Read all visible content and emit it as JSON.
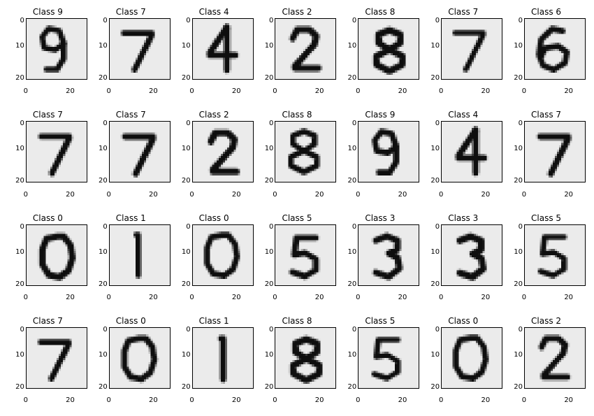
{
  "grid": {
    "rows": 4,
    "cols": 7
  },
  "axes": {
    "y_ticks": [
      0,
      10,
      20
    ],
    "x_ticks": [
      0,
      20
    ],
    "xlim": [
      0,
      27
    ],
    "ylim": [
      0,
      27
    ]
  },
  "chart_data": [
    [
      {
        "title": "Class 9",
        "label": 9,
        "type": "image",
        "glyph": "9"
      },
      {
        "title": "Class 7",
        "label": 7,
        "type": "image",
        "glyph": "7"
      },
      {
        "title": "Class 4",
        "label": 4,
        "type": "image",
        "glyph": "4"
      },
      {
        "title": "Class 2",
        "label": 2,
        "type": "image",
        "glyph": "2"
      },
      {
        "title": "Class 8",
        "label": 8,
        "type": "image",
        "glyph": "8"
      },
      {
        "title": "Class 7",
        "label": 7,
        "type": "image",
        "glyph": "7"
      },
      {
        "title": "Class 6",
        "label": 6,
        "type": "image",
        "glyph": "6"
      }
    ],
    [
      {
        "title": "Class 7",
        "label": 7,
        "type": "image",
        "glyph": "7"
      },
      {
        "title": "Class 7",
        "label": 7,
        "type": "image",
        "glyph": "7"
      },
      {
        "title": "Class 2",
        "label": 2,
        "type": "image",
        "glyph": "2"
      },
      {
        "title": "Class 8",
        "label": 8,
        "type": "image",
        "glyph": "8"
      },
      {
        "title": "Class 9",
        "label": 9,
        "type": "image",
        "glyph": "9"
      },
      {
        "title": "Class 4",
        "label": 4,
        "type": "image",
        "glyph": "4"
      },
      {
        "title": "Class 7",
        "label": 7,
        "type": "image",
        "glyph": "7"
      }
    ],
    [
      {
        "title": "Class 0",
        "label": 0,
        "type": "image",
        "glyph": "0"
      },
      {
        "title": "Class 1",
        "label": 1,
        "type": "image",
        "glyph": "1"
      },
      {
        "title": "Class 0",
        "label": 0,
        "type": "image",
        "glyph": "0"
      },
      {
        "title": "Class 5",
        "label": 5,
        "type": "image",
        "glyph": "5"
      },
      {
        "title": "Class 3",
        "label": 3,
        "type": "image",
        "glyph": "3"
      },
      {
        "title": "Class 3",
        "label": 3,
        "type": "image",
        "glyph": "3"
      },
      {
        "title": "Class 5",
        "label": 5,
        "type": "image",
        "glyph": "5"
      }
    ],
    [
      {
        "title": "Class 7",
        "label": 7,
        "type": "image",
        "glyph": "7"
      },
      {
        "title": "Class 0",
        "label": 0,
        "type": "image",
        "glyph": "0"
      },
      {
        "title": "Class 1",
        "label": 1,
        "type": "image",
        "glyph": "1"
      },
      {
        "title": "Class 8",
        "label": 8,
        "type": "image",
        "glyph": "8"
      },
      {
        "title": "Class 5",
        "label": 5,
        "type": "image",
        "glyph": "5"
      },
      {
        "title": "Class 0",
        "label": 0,
        "type": "image",
        "glyph": "0"
      },
      {
        "title": "Class 2",
        "label": 2,
        "type": "image",
        "glyph": "2"
      }
    ]
  ]
}
